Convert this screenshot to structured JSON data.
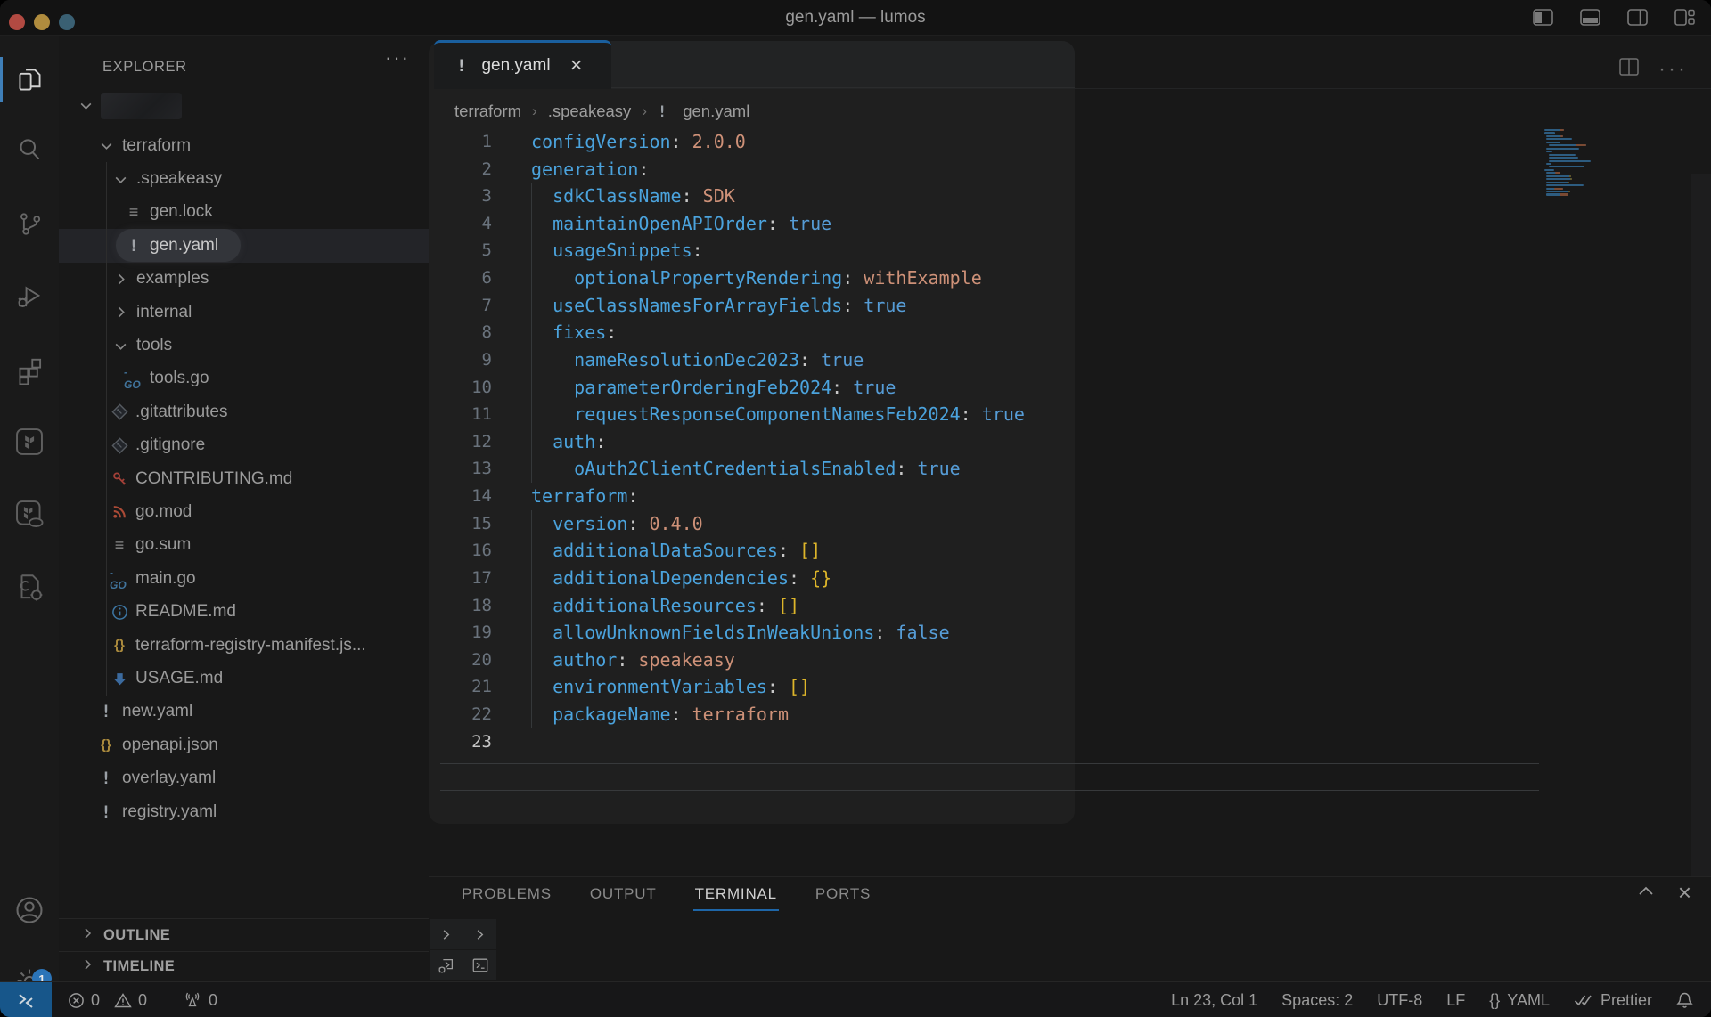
{
  "window": {
    "title": "gen.yaml — lumos"
  },
  "titlebar": {
    "traffic_lights": [
      "close",
      "minimize",
      "zoom"
    ],
    "layout_icons": [
      "toggle-primary-sidebar-icon",
      "toggle-panel-icon",
      "toggle-secondary-sidebar-icon",
      "customize-layout-icon"
    ]
  },
  "activity_bar": {
    "items": [
      {
        "name": "explorer",
        "active": true
      },
      {
        "name": "search"
      },
      {
        "name": "source-control"
      },
      {
        "name": "run-and-debug"
      },
      {
        "name": "extensions"
      },
      {
        "name": "terraform"
      },
      {
        "name": "terraform-cloud"
      },
      {
        "name": "code-tools"
      }
    ],
    "bottom_items": [
      {
        "name": "accounts"
      },
      {
        "name": "settings",
        "badge": "1"
      }
    ]
  },
  "explorer": {
    "title": "EXPLORER",
    "more_label": "···",
    "workspace_redacted": true,
    "tree": [
      {
        "label": "terraform",
        "type": "folder",
        "level": 1,
        "expanded": true
      },
      {
        "label": ".speakeasy",
        "type": "folder",
        "level": 2,
        "expanded": true
      },
      {
        "label": "gen.lock",
        "type": "file",
        "level": 3,
        "icon": "lines-icon"
      },
      {
        "label": "gen.yaml",
        "type": "file",
        "level": 3,
        "icon": "yaml-exclaim-icon",
        "selected": true
      },
      {
        "label": "examples",
        "type": "folder",
        "level": 2,
        "expanded": false
      },
      {
        "label": "internal",
        "type": "folder",
        "level": 2,
        "expanded": false
      },
      {
        "label": "tools",
        "type": "folder",
        "level": 2,
        "expanded": true
      },
      {
        "label": "tools.go",
        "type": "file",
        "level": 3,
        "icon": "go-icon"
      },
      {
        "label": ".gitattributes",
        "type": "file",
        "level": 2,
        "icon": "git-icon"
      },
      {
        "label": ".gitignore",
        "type": "file",
        "level": 2,
        "icon": "git-icon"
      },
      {
        "label": "CONTRIBUTING.md",
        "type": "file",
        "level": 2,
        "icon": "key-icon"
      },
      {
        "label": "go.mod",
        "type": "file",
        "level": 2,
        "icon": "rss-icon"
      },
      {
        "label": "go.sum",
        "type": "file",
        "level": 2,
        "icon": "lines-icon"
      },
      {
        "label": "main.go",
        "type": "file",
        "level": 2,
        "icon": "go-icon"
      },
      {
        "label": "README.md",
        "type": "file",
        "level": 2,
        "icon": "info-icon"
      },
      {
        "label": "terraform-registry-manifest.js...",
        "type": "file",
        "level": 2,
        "icon": "braces-icon"
      },
      {
        "label": "USAGE.md",
        "type": "file",
        "level": 2,
        "icon": "arrow-down-icon"
      },
      {
        "label": "new.yaml",
        "type": "file",
        "level": 1,
        "icon": "yaml-exclaim-icon"
      },
      {
        "label": "openapi.json",
        "type": "file",
        "level": 1,
        "icon": "braces-icon"
      },
      {
        "label": "overlay.yaml",
        "type": "file",
        "level": 1,
        "icon": "yaml-exclaim-icon"
      },
      {
        "label": "registry.yaml",
        "type": "file",
        "level": 1,
        "icon": "yaml-exclaim-icon"
      }
    ],
    "outline_label": "OUTLINE",
    "timeline_label": "TIMELINE"
  },
  "editor": {
    "tab": {
      "icon": "yaml-exclaim-icon",
      "label": "gen.yaml",
      "close": "×"
    },
    "breadcrumb": [
      {
        "label": "terraform"
      },
      {
        "label": ".speakeasy"
      },
      {
        "label": "gen.yaml",
        "icon": "yaml-exclaim-icon"
      }
    ],
    "cursor_line": 23,
    "code_lines": [
      {
        "n": 1,
        "indent": 0,
        "tokens": [
          [
            "k",
            "configVersion"
          ],
          [
            "p",
            ": "
          ],
          [
            "s",
            "2.0.0"
          ]
        ]
      },
      {
        "n": 2,
        "indent": 0,
        "tokens": [
          [
            "k",
            "generation"
          ],
          [
            "p",
            ":"
          ]
        ]
      },
      {
        "n": 3,
        "indent": 2,
        "tokens": [
          [
            "k",
            "sdkClassName"
          ],
          [
            "p",
            ": "
          ],
          [
            "s",
            "SDK"
          ]
        ]
      },
      {
        "n": 4,
        "indent": 2,
        "tokens": [
          [
            "k",
            "maintainOpenAPIOrder"
          ],
          [
            "p",
            ": "
          ],
          [
            "b",
            "true"
          ]
        ]
      },
      {
        "n": 5,
        "indent": 2,
        "tokens": [
          [
            "k",
            "usageSnippets"
          ],
          [
            "p",
            ":"
          ]
        ]
      },
      {
        "n": 6,
        "indent": 4,
        "tokens": [
          [
            "k",
            "optionalPropertyRendering"
          ],
          [
            "p",
            ": "
          ],
          [
            "s",
            "withExample"
          ]
        ]
      },
      {
        "n": 7,
        "indent": 2,
        "tokens": [
          [
            "k",
            "useClassNamesForArrayFields"
          ],
          [
            "p",
            ": "
          ],
          [
            "b",
            "true"
          ]
        ]
      },
      {
        "n": 8,
        "indent": 2,
        "tokens": [
          [
            "k",
            "fixes"
          ],
          [
            "p",
            ":"
          ]
        ]
      },
      {
        "n": 9,
        "indent": 4,
        "tokens": [
          [
            "k",
            "nameResolutionDec2023"
          ],
          [
            "p",
            ": "
          ],
          [
            "b",
            "true"
          ]
        ]
      },
      {
        "n": 10,
        "indent": 4,
        "tokens": [
          [
            "k",
            "parameterOrderingFeb2024"
          ],
          [
            "p",
            ": "
          ],
          [
            "b",
            "true"
          ]
        ]
      },
      {
        "n": 11,
        "indent": 4,
        "tokens": [
          [
            "k",
            "requestResponseComponentNamesFeb2024"
          ],
          [
            "p",
            ": "
          ],
          [
            "b",
            "true"
          ]
        ]
      },
      {
        "n": 12,
        "indent": 2,
        "tokens": [
          [
            "k",
            "auth"
          ],
          [
            "p",
            ":"
          ]
        ]
      },
      {
        "n": 13,
        "indent": 4,
        "tokens": [
          [
            "k",
            "oAuth2ClientCredentialsEnabled"
          ],
          [
            "p",
            ": "
          ],
          [
            "b",
            "true"
          ]
        ]
      },
      {
        "n": 14,
        "indent": 0,
        "tokens": [
          [
            "k",
            "terraform"
          ],
          [
            "p",
            ":"
          ]
        ]
      },
      {
        "n": 15,
        "indent": 2,
        "tokens": [
          [
            "k",
            "version"
          ],
          [
            "p",
            ": "
          ],
          [
            "s",
            "0.4.0"
          ]
        ]
      },
      {
        "n": 16,
        "indent": 2,
        "tokens": [
          [
            "k",
            "additionalDataSources"
          ],
          [
            "p",
            ": "
          ],
          [
            "g",
            "[]"
          ]
        ]
      },
      {
        "n": 17,
        "indent": 2,
        "tokens": [
          [
            "k",
            "additionalDependencies"
          ],
          [
            "p",
            ": "
          ],
          [
            "g",
            "{}"
          ]
        ]
      },
      {
        "n": 18,
        "indent": 2,
        "tokens": [
          [
            "k",
            "additionalResources"
          ],
          [
            "p",
            ": "
          ],
          [
            "g",
            "[]"
          ]
        ]
      },
      {
        "n": 19,
        "indent": 2,
        "tokens": [
          [
            "k",
            "allowUnknownFieldsInWeakUnions"
          ],
          [
            "p",
            ": "
          ],
          [
            "b",
            "false"
          ]
        ]
      },
      {
        "n": 20,
        "indent": 2,
        "tokens": [
          [
            "k",
            "author"
          ],
          [
            "p",
            ": "
          ],
          [
            "s",
            "speakeasy"
          ]
        ]
      },
      {
        "n": 21,
        "indent": 2,
        "tokens": [
          [
            "k",
            "environmentVariables"
          ],
          [
            "p",
            ": "
          ],
          [
            "g",
            "[]"
          ]
        ]
      },
      {
        "n": 22,
        "indent": 2,
        "tokens": [
          [
            "k",
            "packageName"
          ],
          [
            "p",
            ": "
          ],
          [
            "s",
            "terraform"
          ]
        ]
      },
      {
        "n": 23,
        "indent": 0,
        "tokens": []
      }
    ]
  },
  "panel": {
    "tabs": [
      {
        "label": "PROBLEMS"
      },
      {
        "label": "OUTPUT"
      },
      {
        "label": "TERMINAL",
        "active": true
      },
      {
        "label": "PORTS"
      }
    ],
    "side_icons": [
      "chevron-right-icon",
      "chevron-right-icon",
      "debug-terminal-icon",
      "terminal-icon"
    ],
    "actions": [
      "chevron-up-icon",
      "close-icon"
    ]
  },
  "status_bar": {
    "remote_icon": "remote-indicator-icon",
    "errors": "0",
    "warnings": "0",
    "broadcasts": "0",
    "line_col": "Ln 23, Col 1",
    "indentation": "Spaces: 2",
    "encoding": "UTF-8",
    "eol": "LF",
    "language_icon": "{}",
    "language": "YAML",
    "formatter": "Prettier",
    "bell": "notifications-icon"
  },
  "colors": {
    "accent_blue": "#1a5f9e",
    "key_blue": "#4ba3dd",
    "bool_blue": "#569cd6",
    "string_orange": "#ce9178",
    "bracket_gold": "#ddb52a",
    "spotlight_bg": "#1f1f1f",
    "window_bg": "#181818",
    "remote_blue": "#17568a"
  }
}
